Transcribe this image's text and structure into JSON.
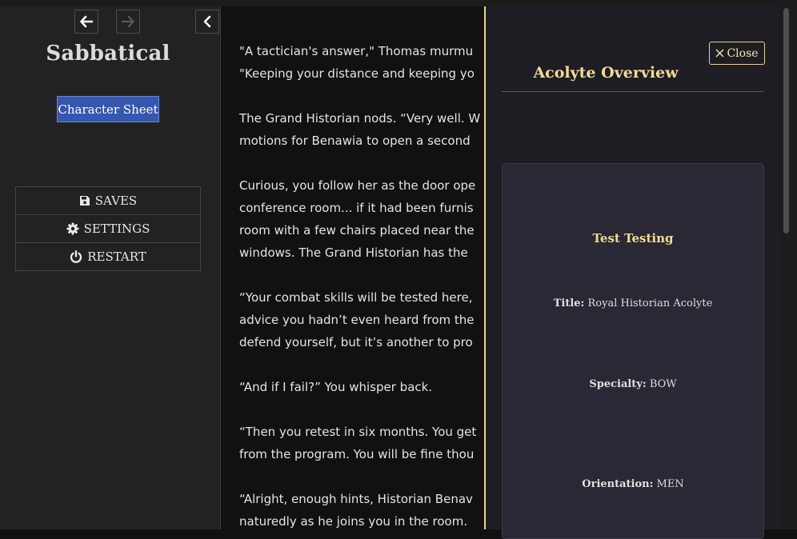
{
  "sidebar": {
    "title": "Sabbatical",
    "character_sheet_label": "Character Sheet",
    "menu": [
      {
        "label": "SAVES",
        "icon": "floppy-disk-icon"
      },
      {
        "label": "SETTINGS",
        "icon": "gear-icon"
      },
      {
        "label": "RESTART",
        "icon": "power-icon"
      }
    ]
  },
  "story": {
    "paragraphs": [
      "\"A tactician's answer,\" Thomas murmu",
      "\"Keeping your distance and keeping yo",
      "The Grand Historian nods. “Very well. W",
      "motions for Benawia to open a second",
      "Curious, you follow her as the door ope",
      "conference room... if it had been furnis",
      "room with a few chairs placed near the",
      "windows. The Grand Historian has the",
      "“Your combat skills will be tested here,",
      "advice you hadn’t even heard from the",
      "defend yourself, but it’s another to pro",
      "“And if I fail?” You whisper back.",
      "“Then you retest in six months. You get",
      "from the program. You will be fine thou",
      "“Alright, enough hints, Historian Benav",
      "naturedly as he joins you in the room."
    ]
  },
  "overview": {
    "title": "Acolyte Overview",
    "close_label": "Close",
    "name": "Test Testing",
    "fields": {
      "title_label": "Title:",
      "title_value": "Royal Historian Acolyte",
      "specialty_label": "Specialty:",
      "specialty_value": "BOW",
      "orientation_label": "Orientation:",
      "orientation_value": "MEN"
    }
  },
  "colors": {
    "accent_gold": "#e6d28a",
    "button_blue": "#3557b0",
    "panel_bg": "#1f1d24"
  }
}
